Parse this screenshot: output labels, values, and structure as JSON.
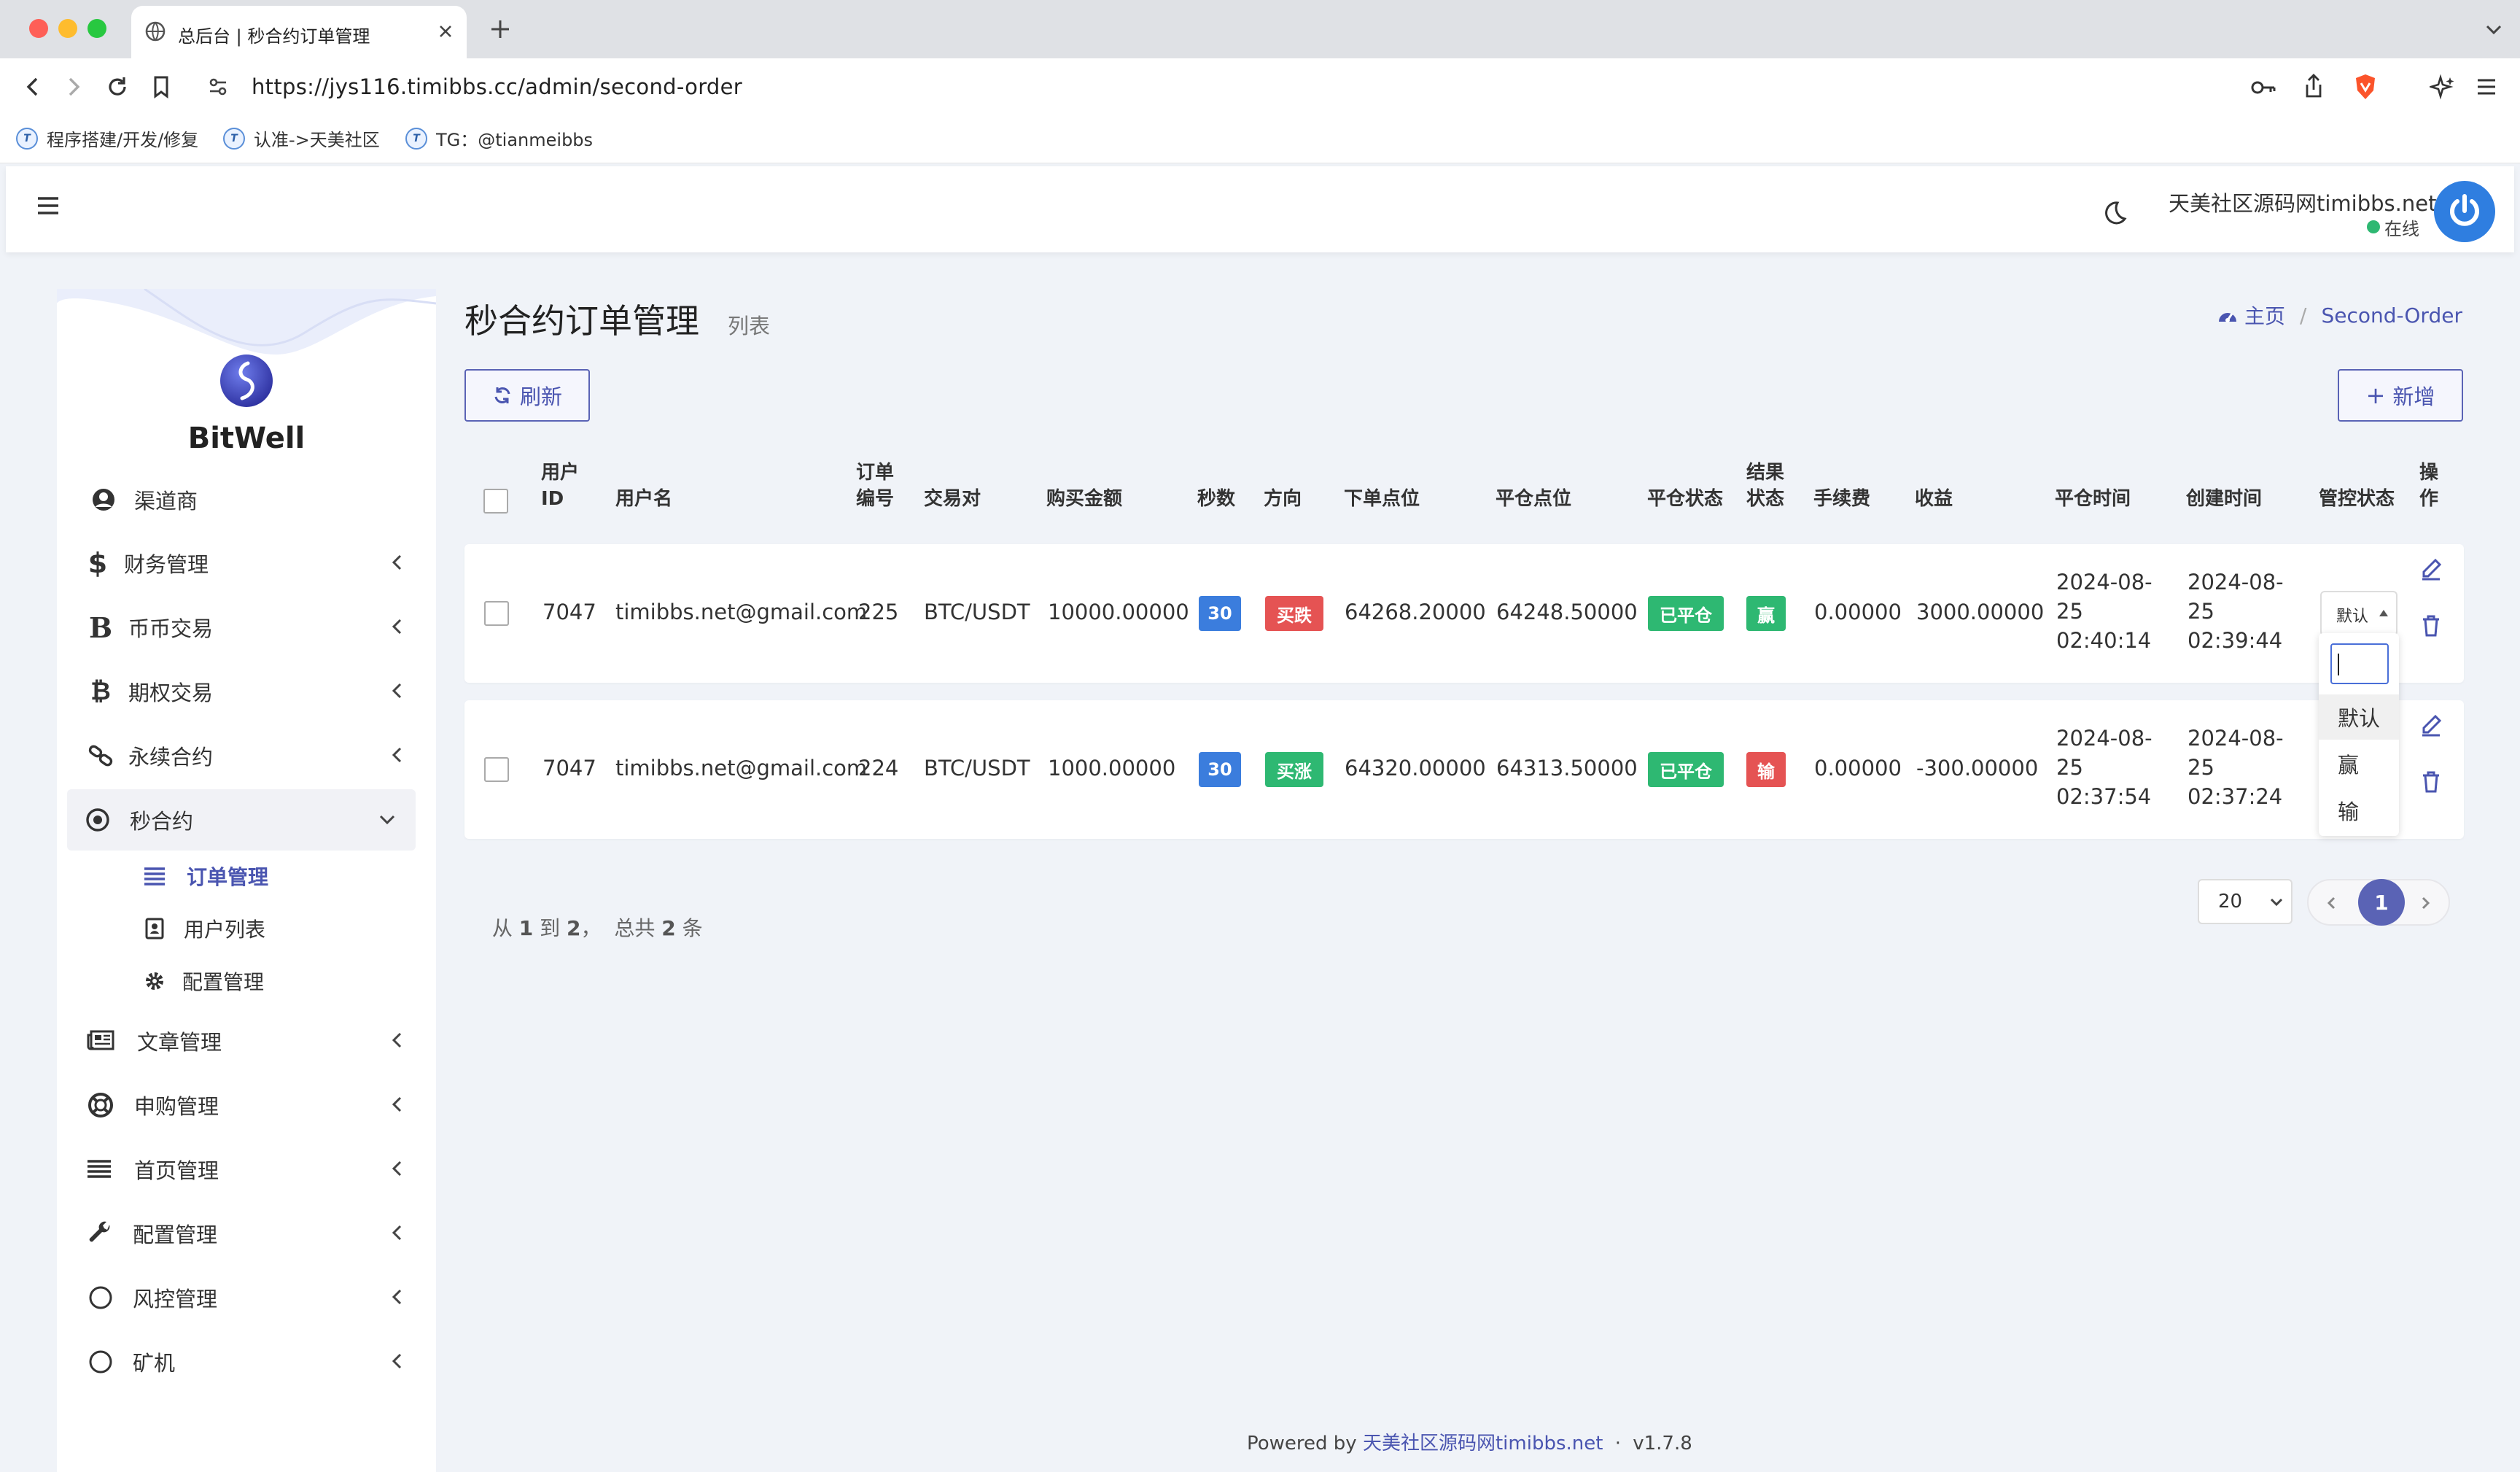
{
  "browser": {
    "tab_title": "总后台 | 秒合约订单管理",
    "url": "https://jys116.timibbs.cc/admin/second-order",
    "bookmarks": [
      "程序搭建/开发/修复",
      "认准->天美社区",
      "TG：@tianmeibbs"
    ]
  },
  "header": {
    "site_name": "天美社区源码网timibbs.net",
    "status": "在线"
  },
  "sidebar": {
    "brand": "BitWell",
    "items": [
      {
        "label": "渠道商",
        "icon": "user-circle-icon"
      },
      {
        "label": "财务管理",
        "icon": "dollar-icon"
      },
      {
        "label": "币币交易",
        "icon": "bold-b-icon"
      },
      {
        "label": "期权交易",
        "icon": "bitcoin-icon"
      },
      {
        "label": "永续合约",
        "icon": "link-icon"
      },
      {
        "label": "秒合约",
        "icon": "dot-circle-icon"
      },
      {
        "label": "文章管理",
        "icon": "newspaper-icon"
      },
      {
        "label": "申购管理",
        "icon": "life-ring-icon"
      },
      {
        "label": "首页管理",
        "icon": "list-icon"
      },
      {
        "label": "配置管理",
        "icon": "wrench-icon"
      },
      {
        "label": "风控管理",
        "icon": "circle-icon"
      },
      {
        "label": "矿机",
        "icon": "circle-icon"
      }
    ],
    "subitems": [
      {
        "label": "订单管理",
        "icon": "list-icon",
        "active": true
      },
      {
        "label": "用户列表",
        "icon": "contact-card-icon"
      },
      {
        "label": "配置管理",
        "icon": "cog-icon"
      }
    ]
  },
  "page": {
    "title": "秒合约订单管理",
    "subtitle": "列表",
    "breadcrumb": {
      "home": "主页",
      "current": "Second-Order"
    },
    "refresh_label": "刷新",
    "add_label": "新增"
  },
  "table": {
    "headers": {
      "user_id_1": "用户",
      "user_id_2": "ID",
      "username": "用户名",
      "order_no_1": "订单",
      "order_no_2": "编号",
      "pair": "交易对",
      "amount": "购买金额",
      "seconds": "秒数",
      "direction": "方向",
      "open_price": "下单点位",
      "close_price": "平仓点位",
      "close_status": "平仓状态",
      "result_1": "结果",
      "result_2": "状态",
      "fee": "手续费",
      "profit": "收益",
      "close_time": "平仓时间",
      "create_time": "创建时间",
      "control": "管控状态",
      "ops_1": "操",
      "ops_2": "作"
    },
    "rows": [
      {
        "user_id": "7047",
        "username": "timibbs.net@gmail.com",
        "order_no": "225",
        "pair": "BTC/USDT",
        "amount": "10000.00000",
        "seconds": "30",
        "direction": "买跌",
        "open_price": "64268.20000",
        "close_price": "64248.50000",
        "close_status": "已平仓",
        "result": "赢",
        "fee": "0.00000",
        "profit": "3000.00000",
        "close_time": "2024-08-25 02:40:14",
        "create_time": "2024-08-25 02:39:44",
        "control": "默认"
      },
      {
        "user_id": "7047",
        "username": "timibbs.net@gmail.com",
        "order_no": "224",
        "pair": "BTC/USDT",
        "amount": "1000.00000",
        "seconds": "30",
        "direction": "买涨",
        "open_price": "64320.00000",
        "close_price": "64313.50000",
        "close_status": "已平仓",
        "result": "输",
        "fee": "0.00000",
        "profit": "-300.00000",
        "close_time": "2024-08-25 02:37:54",
        "create_time": "2024-08-25 02:37:24",
        "control": ""
      }
    ],
    "control_options": [
      "默认",
      "赢",
      "输"
    ]
  },
  "pagination": {
    "summary_parts": [
      "从",
      "1",
      "到",
      "2",
      "，  总共",
      "2",
      "条"
    ],
    "per_page": "20",
    "current_page": "1"
  },
  "footer": {
    "powered": "Powered by",
    "link": "天美社区源码网timibbs.net",
    "sep": "·",
    "version": "v1.7.8"
  },
  "colors": {
    "accent": "#4a55b0",
    "blue_badge": "#3b7ddd",
    "red_badge": "#e55353",
    "green_badge": "#2eb872",
    "background": "#f0f3f8"
  }
}
